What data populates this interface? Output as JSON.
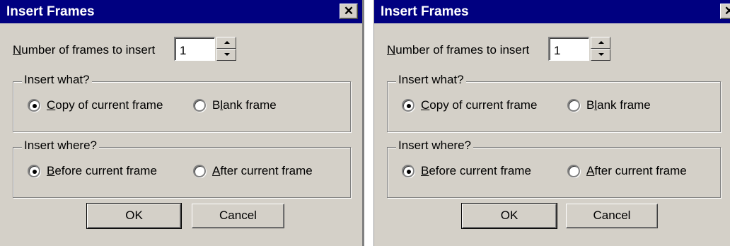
{
  "dialogs": [
    {
      "title": "Insert Frames",
      "close_glyph": "✕",
      "number_label": {
        "prefix": "N",
        "rest": "umber of frames to insert"
      },
      "number_value": "1",
      "insert_what": {
        "legend": "Insert what?",
        "options": [
          {
            "label_ul": "C",
            "label_rest": "opy of current frame",
            "selected": true
          },
          {
            "label_pre": "B",
            "label_ul": "l",
            "label_rest": "ank frame",
            "selected": false
          }
        ]
      },
      "insert_where": {
        "legend": "Insert where?",
        "options": [
          {
            "label_ul": "B",
            "label_rest": "efore current frame",
            "selected": true
          },
          {
            "label_ul": "A",
            "label_rest": "fter current frame",
            "selected": false
          }
        ]
      },
      "ok_label": "OK",
      "cancel_label": "Cancel"
    },
    {
      "title": "Insert Frames",
      "close_glyph": "✕",
      "number_label": {
        "prefix": "N",
        "rest": "umber of frames to insert"
      },
      "number_value": "1",
      "insert_what": {
        "legend": "Insert what?",
        "options": [
          {
            "label_ul": "C",
            "label_rest": "opy of current frame",
            "selected": true
          },
          {
            "label_pre": "B",
            "label_ul": "l",
            "label_rest": "ank frame",
            "selected": false
          }
        ]
      },
      "insert_where": {
        "legend": "Insert where?",
        "options": [
          {
            "label_ul": "B",
            "label_rest": "efore current frame",
            "selected": true
          },
          {
            "label_ul": "A",
            "label_rest": "fter current frame",
            "selected": false
          }
        ]
      },
      "ok_label": "OK",
      "cancel_label": "Cancel"
    }
  ]
}
